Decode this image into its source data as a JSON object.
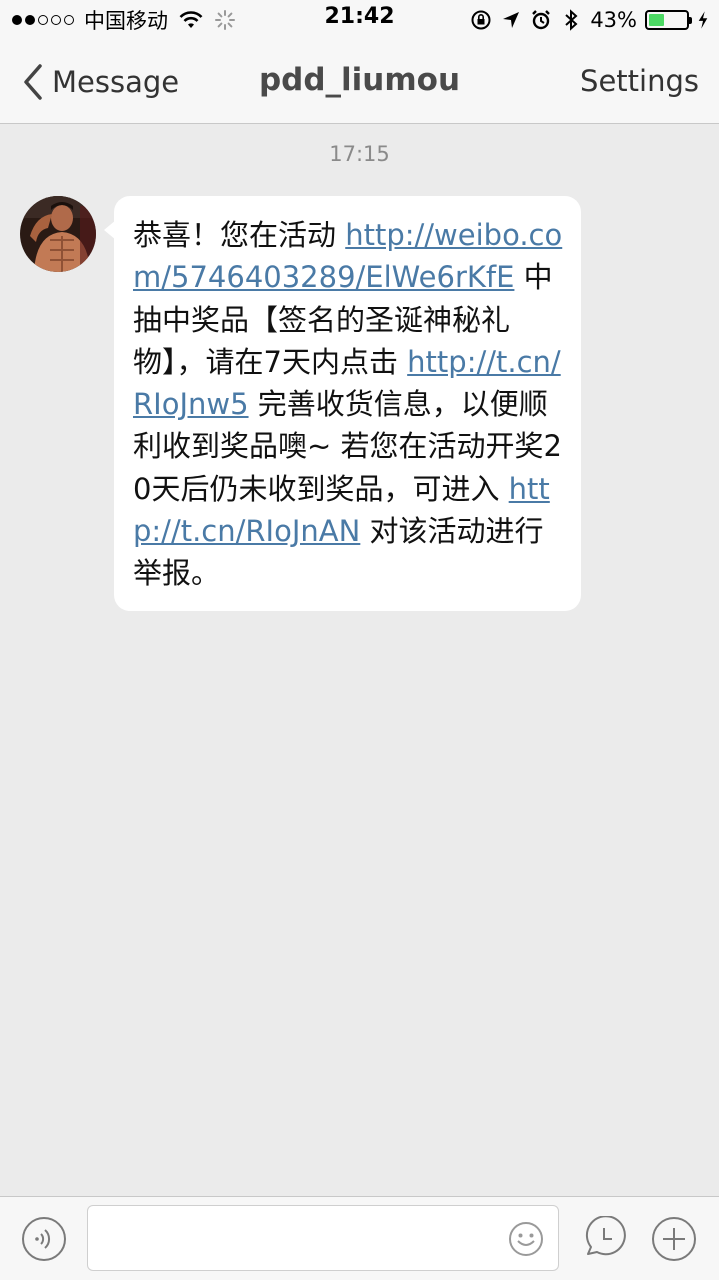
{
  "status_bar": {
    "carrier": "中国移动",
    "time": "21:42",
    "battery_percent": "43%",
    "battery_level": 0.43,
    "battery_color": "#4cd964"
  },
  "nav": {
    "back_label": "Message",
    "title": "pdd_liumou",
    "settings_label": "Settings"
  },
  "chat": {
    "timestamp": "17:15",
    "message": {
      "segments": [
        {
          "text": "恭喜！您在活动 ",
          "link": false
        },
        {
          "text": "http://weibo.com/5746403289/ElWe6rKfE",
          "link": true
        },
        {
          "text": " 中抽中奖品【签名的圣诞神秘礼物】，请在7天内点击 ",
          "link": false
        },
        {
          "text": "http://t.cn/RIoJnw5",
          "link": true
        },
        {
          "text": " 完善收货信息，以便顺利收到奖品噢~ 若您在活动开奖20天后仍未收到奖品，可进入 ",
          "link": false
        },
        {
          "text": "http://t.cn/RIoJnAN",
          "link": true
        },
        {
          "text": " 对该活动进行举报。",
          "link": false
        }
      ]
    },
    "link_color": "#4a7aa6"
  },
  "input_bar": {
    "placeholder": ""
  },
  "icons": {
    "back": "chevron-left-icon",
    "voice": "voice-icon",
    "emoji": "smiley-icon",
    "history": "clock-icon",
    "add": "plus-icon"
  }
}
